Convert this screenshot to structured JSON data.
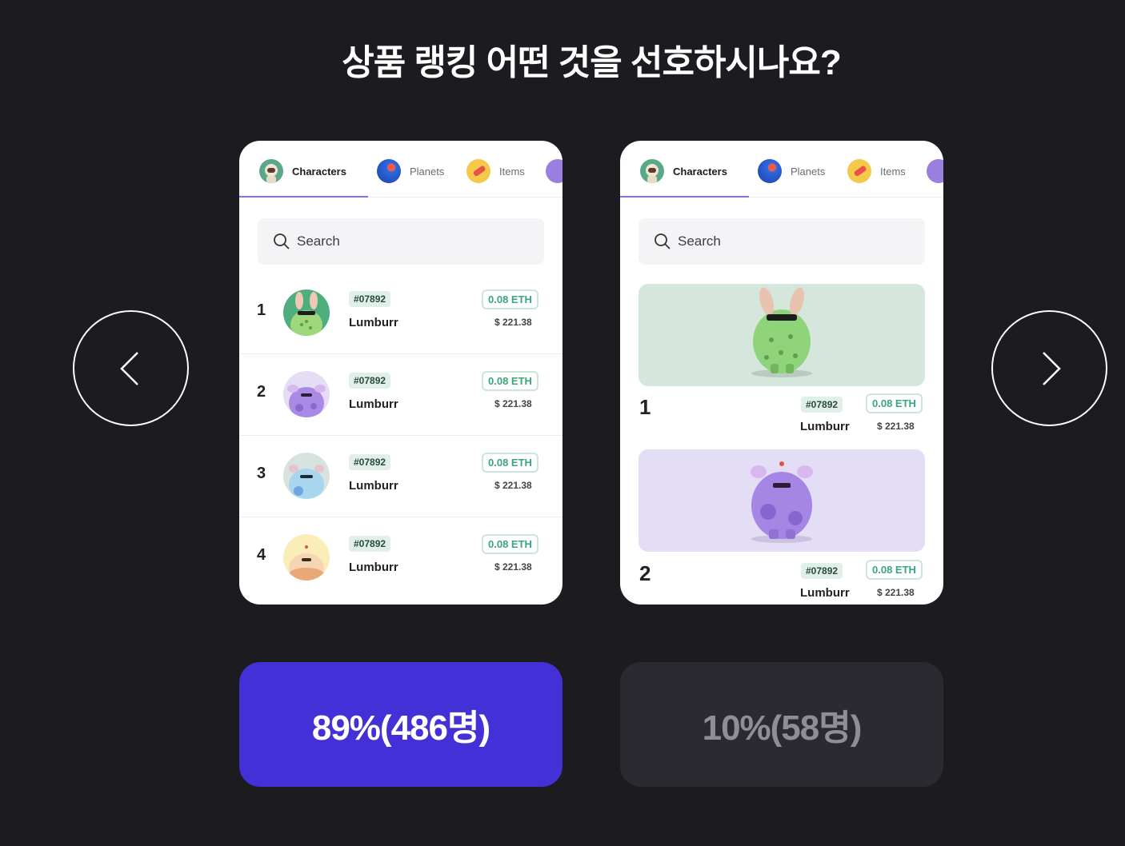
{
  "page": {
    "title": "상품 랭킹 어떤 것을 선호하시나요?"
  },
  "tabs": [
    {
      "label": "Characters",
      "icon": "astronaut-icon"
    },
    {
      "label": "Planets",
      "icon": "planet-icon"
    },
    {
      "label": "Items",
      "icon": "item-icon"
    }
  ],
  "search": {
    "placeholder": "Search"
  },
  "list_items": [
    {
      "rank": "1",
      "tag": "#07892",
      "name": "Lumburr",
      "eth": "0.08 ETH",
      "usd": "$ 221.38",
      "color": "#4fae7e"
    },
    {
      "rank": "2",
      "tag": "#07892",
      "name": "Lumburr",
      "eth": "0.08 ETH",
      "usd": "$ 221.38",
      "color": "#e5dcf5"
    },
    {
      "rank": "3",
      "tag": "#07892",
      "name": "Lumburr",
      "eth": "0.08 ETH",
      "usd": "$ 221.38",
      "color": "#d6e3df"
    },
    {
      "rank": "4",
      "tag": "#07892",
      "name": "Lumburr",
      "eth": "0.08 ETH",
      "usd": "$ 221.38",
      "color": "#fbedb8"
    }
  ],
  "card_items": [
    {
      "rank": "1",
      "tag": "#07892",
      "name": "Lumburr",
      "eth": "0.08 ETH",
      "usd": "$ 221.38",
      "color": "#d5e6dc"
    },
    {
      "rank": "2",
      "tag": "#07892",
      "name": "Lumburr",
      "eth": "0.08 ETH",
      "usd": "$ 221.38",
      "color": "#e3def5"
    }
  ],
  "votes": {
    "option_a": {
      "label": "89%(486명)",
      "percent": 89,
      "count": 486
    },
    "option_b": {
      "label": "10%(58명)",
      "percent": 10,
      "count": 58
    }
  },
  "colors": {
    "background": "#1c1c20",
    "accent": "#4330d6",
    "eth_green": "#3aa67a",
    "tab_underline": "#8b6cf0"
  }
}
